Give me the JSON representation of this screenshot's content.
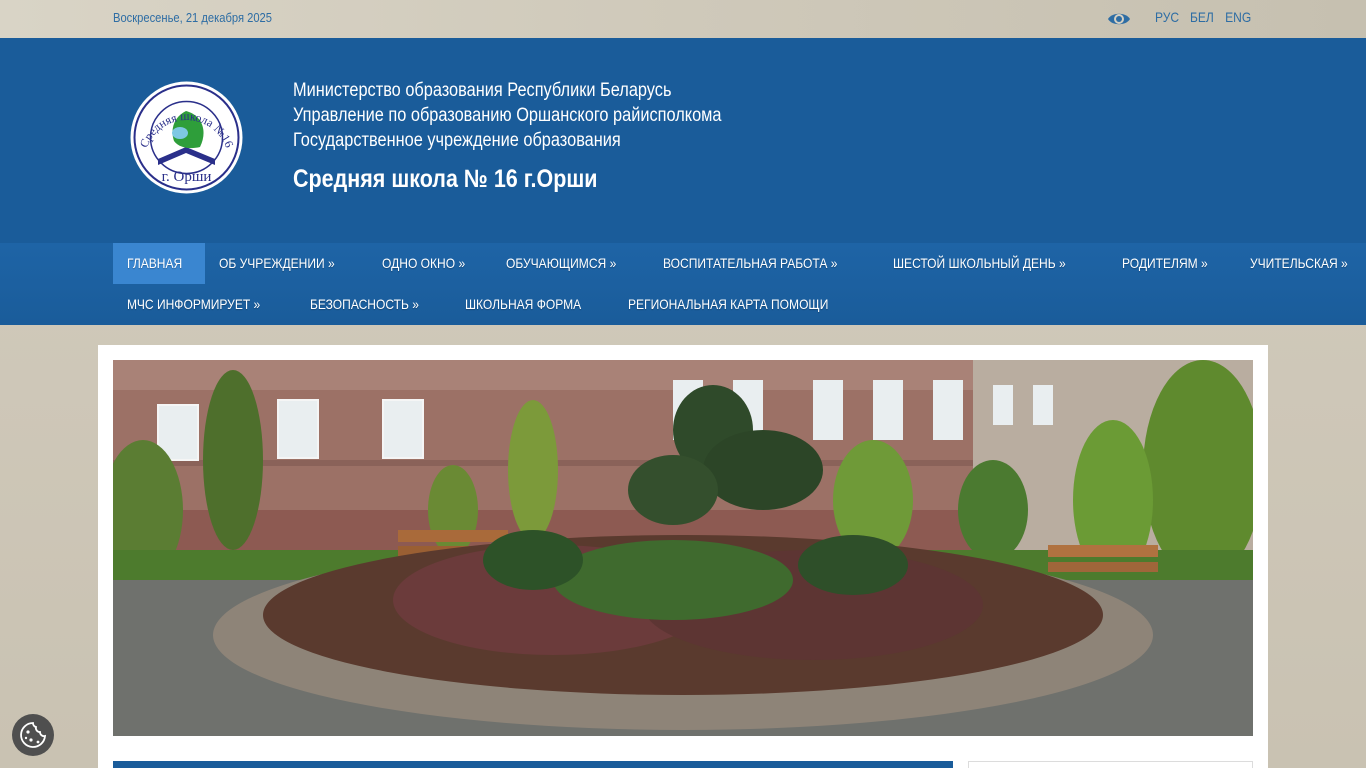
{
  "topbar": {
    "date": "Воскресенье, 21 декабря 2025",
    "langs": [
      "РУС",
      "БЕЛ",
      "ENG"
    ]
  },
  "header": {
    "line1": "Министерство образования Республики Беларусь",
    "line2": "Управление по образованию Оршанского райисполкома",
    "line3": "Государственное учреждение образования",
    "school": "Средняя школа № 16 г.Орши",
    "logo_text_top": "Средняя школа №16",
    "logo_text_bottom": "г. Орши"
  },
  "nav": {
    "row1": [
      {
        "label": "ГЛАВНАЯ",
        "active": true
      },
      {
        "label": "ОБ УЧРЕЖДЕНИИ »"
      },
      {
        "label": "ОДНО ОКНО »"
      },
      {
        "label": "ОБУЧАЮЩИМСЯ »"
      },
      {
        "label": "ВОСПИТАТЕЛЬНАЯ РАБОТА »"
      },
      {
        "label": "ШЕСТОЙ ШКОЛЬНЫЙ ДЕНЬ »"
      },
      {
        "label": "РОДИТЕЛЯМ »"
      },
      {
        "label": "УЧИТЕЛЬСКАЯ »"
      }
    ],
    "row2": [
      {
        "label": "МЧС ИНФОРМИРУЕТ »"
      },
      {
        "label": "БЕЗОПАСНОСТЬ »"
      },
      {
        "label": "ШКОЛЬНАЯ ФОРМА"
      },
      {
        "label": "РЕГИОНАЛЬНАЯ КАРТА ПОМОЩИ"
      }
    ]
  },
  "icons": {
    "eye": "eye-icon",
    "cookie": "cookie-icon"
  },
  "colors": {
    "header_bg": "#1a5c9a",
    "nav_active": "#3a86d0",
    "link": "#2e6da4"
  }
}
